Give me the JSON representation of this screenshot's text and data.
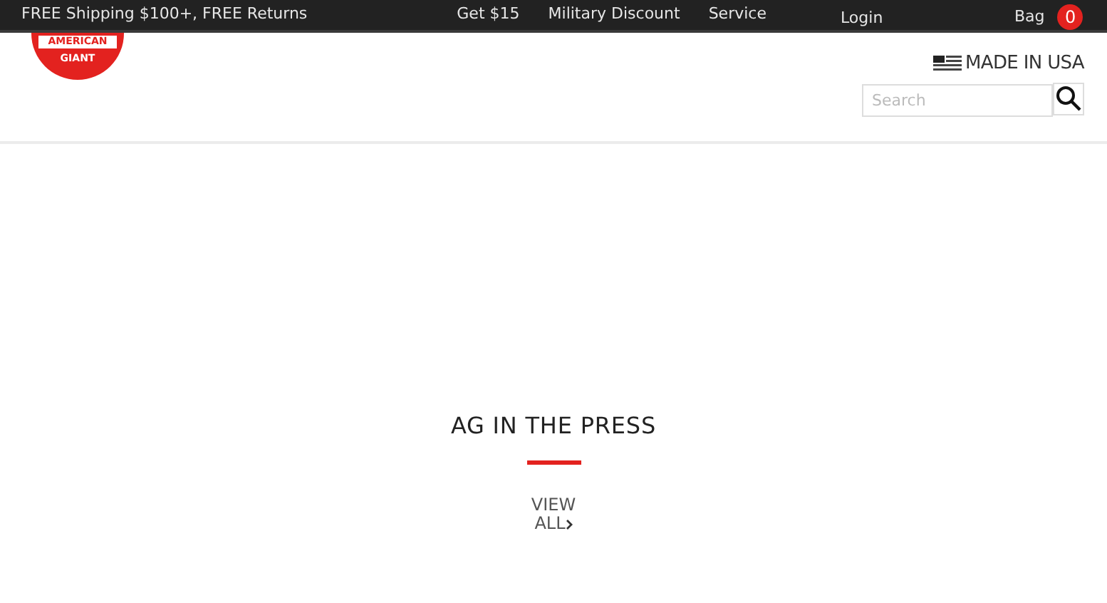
{
  "top_bar": {
    "promo": "FREE Shipping $100+, FREE Returns",
    "links": [
      "Get $15",
      "Military Discount",
      "Service"
    ],
    "login": "Login",
    "bag": {
      "label": "Bag",
      "count": "0"
    }
  },
  "logo": {
    "line_1": "AMERICAN",
    "line_2": "GIANT"
  },
  "header": {
    "made_in": "MADE IN USA",
    "search": {
      "placeholder": "Search"
    }
  },
  "press": {
    "title": "AG IN THE PRESS",
    "link_line_1": "VIEW",
    "link_line_2": "ALL"
  }
}
